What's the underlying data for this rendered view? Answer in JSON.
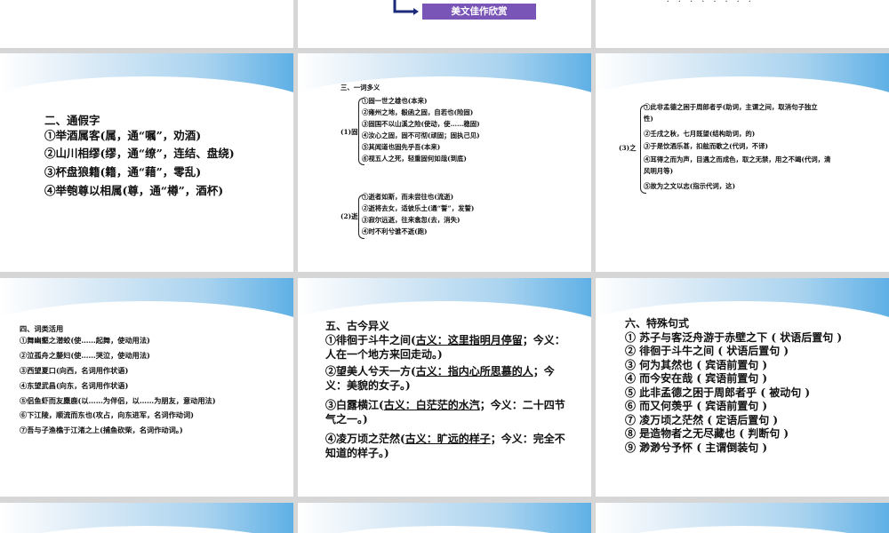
{
  "top_row": {
    "button_label": "美文佳作欣赏",
    "right_text": "· · · · · · · ·"
  },
  "slide_tongjia": {
    "title": "二、通假字",
    "items": [
      "①举酒属客(属，通“嘱”，劝酒)",
      "②山川相缪(缪，通“缭”，连结、盘绕)",
      "③杯盘狼籍(籍，通“藉”，零乱)",
      "④举匏尊以相属(尊，通“樽”，酒杯)"
    ]
  },
  "slide_yicimeiyi": {
    "title": "三、一词多义",
    "gu_label": "(1)固",
    "gu_items": [
      "①固一世之雄也(本来)",
      "②雍州之地，殽函之固，自若也(险固)",
      "③固国不以山溪之险(使动，使……稳固)",
      "④汝心之固，固不可彻(顽固；固执己见)",
      "⑤其闻道也固先乎吾(本来)",
      "⑥视五人之死，轻重固何如哉(到底)"
    ],
    "shi_label": "(2)逝",
    "shi_items": [
      "①逝者如斯，而未尝往也(流逝)",
      "②逝将去女，适彼乐土(通“誓”，发誓)",
      "③寂尔远逝，往来翕忽(去，消失)",
      "④时不利兮骓不逝(跑)"
    ]
  },
  "slide_zhi": {
    "label": "(3)之",
    "items": [
      "①此非孟德之困于周郎者乎(助词，主谓之间，取消句子独立性)",
      "②壬戌之秋，七月既望(结构助词，的)",
      "③于是饮酒乐甚，扣舷而歌之(代词，不译)",
      "④耳得之而为声，目遇之而成色，取之无禁，用之不竭(代词，清风明月等)",
      "⑤故为之文以志(指示代词，这)"
    ]
  },
  "slide_huoyong": {
    "title": "四、词类活用",
    "items": [
      "①舞幽壑之潜蛟(使……起舞，使动用法)",
      "②泣孤舟之嫠妇(使……哭泣，使动用法)",
      "③西望夏口(向西，名词用作状语)",
      "④东望武昌(向东，名词用作状语)",
      "⑤侣鱼虾而友麋鹿(以……为伴侣，以……为朋友，意动用法)",
      "⑥下江陵，顺流而东也(攻占，向东进军，名词作动词)",
      "⑦吾与子渔樵于江渚之上(捕鱼砍柴，名词作动词。)"
    ]
  },
  "slide_gujin": {
    "title": "五、古今异义",
    "items": [
      {
        "pre": "①徘徊于斗牛之间(",
        "gu": "古义：这里指明月停留",
        "post": "；今义：人在一个地方来回走动。)"
      },
      {
        "pre": "②望美人兮天一方(",
        "gu": "古义：指内心所思慕的人",
        "post": "；今义：美貌的女子。)"
      },
      {
        "pre": "③白露横江(",
        "gu": "古义：白茫茫的水汽",
        "post": "；今义：二十四节气之一。)"
      },
      {
        "pre": "④凌万顷之茫然(",
        "gu": "古义：旷远的样子",
        "post": "；今义：完全不知道的样子。)"
      }
    ]
  },
  "slide_jushi": {
    "title": "六、特殊句式",
    "items": [
      "① 苏子与客泛舟游于赤壁之下 ( 状语后置句 )",
      "② 徘徊于斗牛之间 ( 状语后置句 )",
      "③ 何为其然也 ( 宾语前置句 )",
      "④ 而今安在哉 ( 宾语前置句 )",
      "⑤ 此非孟德之困于周郎者乎 ( 被动句 )",
      "⑥ 而又何羡乎 ( 宾语前置句 )",
      "⑦ 凌万顷之茫然 ( 定语后置句 )",
      "⑧ 是造物者之无尽藏也 ( 判断句 )",
      "⑨ 渺渺兮予怀 ( 主谓倒装句 )"
    ]
  },
  "colors": {
    "button": "#7a55b8",
    "band_blue": "#5fb0e6",
    "gap": "#d6d6d6"
  }
}
